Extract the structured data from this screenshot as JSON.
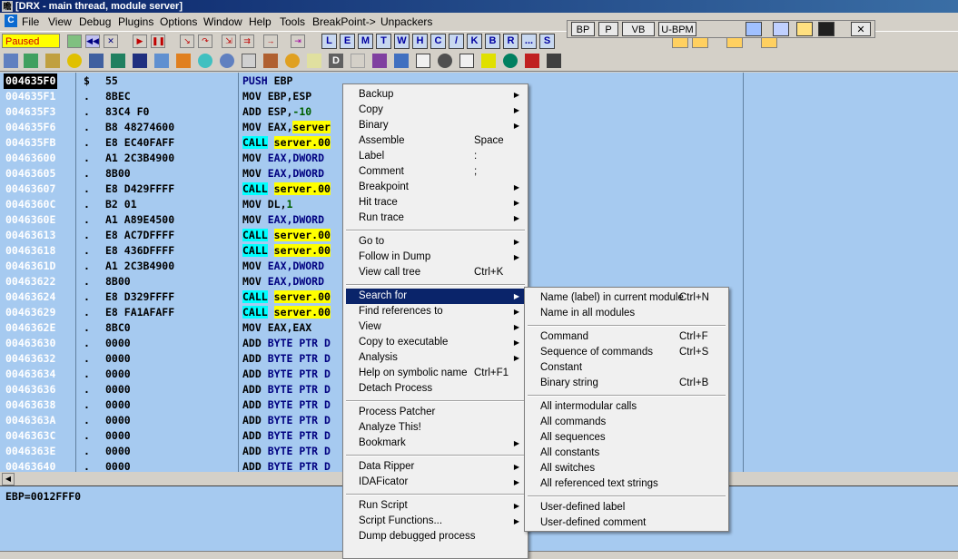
{
  "window": {
    "title": "[DRX - main thread, module server]",
    "icon_char": "瞻"
  },
  "menubar": {
    "items": [
      "File",
      "Debug",
      "View",
      "Plugins",
      "Options",
      "Window",
      "Help",
      "Tools",
      "BreakPoint->",
      "Unpackers"
    ]
  },
  "toolbar": {
    "status": "Paused",
    "letter_buttons": [
      "L",
      "E",
      "M",
      "T",
      "W",
      "H",
      "C",
      "/",
      "K",
      "B",
      "R",
      "...",
      "S"
    ]
  },
  "bp_toolbar": {
    "buttons": [
      "BP",
      "P",
      "VB",
      "U-BPM"
    ]
  },
  "disasm": {
    "rows": [
      {
        "addr": "004635F0",
        "mark": "$",
        "hex": "55",
        "op": "PUSH",
        "arg": "EBP",
        "call": false
      },
      {
        "addr": "004635F1",
        "mark": ".",
        "hex": "8BEC",
        "op": "MOV",
        "arg": "EBP,ESP",
        "call": false
      },
      {
        "addr": "004635F3",
        "mark": ".",
        "hex": "83C4 F0",
        "op": "ADD",
        "arg": "ESP,",
        "num": "-10",
        "call": false
      },
      {
        "addr": "004635F6",
        "mark": ".",
        "hex": "B8 48274600",
        "op": "MOV",
        "arg": "EAX,",
        "yarg": "server",
        "call": false
      },
      {
        "addr": "004635FB",
        "mark": ".",
        "hex": "E8 EC40FAFF",
        "op": "CALL",
        "yarg": "server.00",
        "call": true
      },
      {
        "addr": "00463600",
        "mark": ".",
        "hex": "A1 2C3B4900",
        "op": "MOV",
        "arg": "EAX,DWORD",
        "call": false
      },
      {
        "addr": "00463605",
        "mark": ".",
        "hex": "8B00",
        "op": "MOV",
        "arg": "EAX,DWORD",
        "call": false
      },
      {
        "addr": "00463607",
        "mark": ".",
        "hex": "E8 D429FFFF",
        "op": "CALL",
        "yarg": "server.00",
        "call": true
      },
      {
        "addr": "0046360C",
        "mark": ".",
        "hex": "B2 01",
        "op": "MOV",
        "arg": "DL,",
        "num": "1",
        "call": false
      },
      {
        "addr": "0046360E",
        "mark": ".",
        "hex": "A1 A89E4500",
        "op": "MOV",
        "arg": "EAX,DWORD",
        "call": false
      },
      {
        "addr": "00463613",
        "mark": ".",
        "hex": "E8 AC7DFFFF",
        "op": "CALL",
        "yarg": "server.00",
        "call": true
      },
      {
        "addr": "00463618",
        "mark": ".",
        "hex": "E8 436DFFFF",
        "op": "CALL",
        "yarg": "server.00",
        "call": true
      },
      {
        "addr": "0046361D",
        "mark": ".",
        "hex": "A1 2C3B4900",
        "op": "MOV",
        "arg": "EAX,DWORD",
        "call": false
      },
      {
        "addr": "00463622",
        "mark": ".",
        "hex": "8B00",
        "op": "MOV",
        "arg": "EAX,DWORD",
        "call": false
      },
      {
        "addr": "00463624",
        "mark": ".",
        "hex": "E8 D329FFFF",
        "op": "CALL",
        "yarg": "server.00",
        "call": true
      },
      {
        "addr": "00463629",
        "mark": ".",
        "hex": "E8 FA1AFAFF",
        "op": "CALL",
        "yarg": "server.00",
        "call": true
      },
      {
        "addr": "0046362E",
        "mark": ".",
        "hex": "8BC0",
        "op": "MOV",
        "arg": "EAX,EAX",
        "call": false
      },
      {
        "addr": "00463630",
        "mark": ".",
        "hex": "0000",
        "op": "ADD",
        "arg": "BYTE PTR D",
        "call": false
      },
      {
        "addr": "00463632",
        "mark": ".",
        "hex": "0000",
        "op": "ADD",
        "arg": "BYTE PTR D",
        "call": false
      },
      {
        "addr": "00463634",
        "mark": ".",
        "hex": "0000",
        "op": "ADD",
        "arg": "BYTE PTR D",
        "call": false
      },
      {
        "addr": "00463636",
        "mark": ".",
        "hex": "0000",
        "op": "ADD",
        "arg": "BYTE PTR D",
        "call": false
      },
      {
        "addr": "00463638",
        "mark": ".",
        "hex": "0000",
        "op": "ADD",
        "arg": "BYTE PTR D",
        "call": false
      },
      {
        "addr": "0046363A",
        "mark": ".",
        "hex": "0000",
        "op": "ADD",
        "arg": "BYTE PTR D",
        "call": false
      },
      {
        "addr": "0046363C",
        "mark": ".",
        "hex": "0000",
        "op": "ADD",
        "arg": "BYTE PTR D",
        "call": false
      },
      {
        "addr": "0046363E",
        "mark": ".",
        "hex": "0000",
        "op": "ADD",
        "arg": "BYTE PTR D",
        "call": false
      },
      {
        "addr": "00463640",
        "mark": ".",
        "hex": "0000",
        "op": "ADD",
        "arg": "BYTE PTR D",
        "call": false
      }
    ]
  },
  "info": {
    "text": "EBP=0012FFF0"
  },
  "context_menu": {
    "items": [
      {
        "label": "Backup",
        "shortcut": "",
        "sub": true
      },
      {
        "label": "Copy",
        "shortcut": "",
        "sub": true
      },
      {
        "label": "Binary",
        "shortcut": "",
        "sub": true
      },
      {
        "label": "Assemble",
        "shortcut": "Space",
        "sub": false
      },
      {
        "label": "Label",
        "shortcut": ":",
        "sub": false
      },
      {
        "label": "Comment",
        "shortcut": ";",
        "sub": false
      },
      {
        "label": "Breakpoint",
        "shortcut": "",
        "sub": true
      },
      {
        "label": "Hit trace",
        "shortcut": "",
        "sub": true
      },
      {
        "label": "Run trace",
        "shortcut": "",
        "sub": true
      },
      {
        "sep": true
      },
      {
        "label": "Go to",
        "shortcut": "",
        "sub": true
      },
      {
        "label": "Follow in Dump",
        "shortcut": "",
        "sub": true
      },
      {
        "label": "View call tree",
        "shortcut": "Ctrl+K",
        "sub": false
      },
      {
        "sep": true
      },
      {
        "label": "Search for",
        "shortcut": "",
        "sub": true,
        "hl": true
      },
      {
        "label": "Find references to",
        "shortcut": "",
        "sub": true
      },
      {
        "label": "View",
        "shortcut": "",
        "sub": true
      },
      {
        "label": "Copy to executable",
        "shortcut": "",
        "sub": true
      },
      {
        "label": "Analysis",
        "shortcut": "",
        "sub": true
      },
      {
        "label": "Help on symbolic name",
        "shortcut": "Ctrl+F1",
        "sub": false
      },
      {
        "label": "Detach Process",
        "shortcut": "",
        "sub": false
      },
      {
        "sep": true
      },
      {
        "label": "Process Patcher",
        "shortcut": "",
        "sub": false
      },
      {
        "label": "Analyze This!",
        "shortcut": "",
        "sub": false
      },
      {
        "label": "Bookmark",
        "shortcut": "",
        "sub": true
      },
      {
        "sep": true
      },
      {
        "label": "Data Ripper",
        "shortcut": "",
        "sub": true
      },
      {
        "label": "IDAFicator",
        "shortcut": "",
        "sub": true
      },
      {
        "sep": true
      },
      {
        "label": "Run Script",
        "shortcut": "",
        "sub": true
      },
      {
        "label": "Script Functions...",
        "shortcut": "",
        "sub": true
      },
      {
        "label": "Dump debugged process",
        "shortcut": "",
        "sub": false
      }
    ]
  },
  "submenu": {
    "items": [
      {
        "label": "Name (label) in current module",
        "shortcut": "Ctrl+N"
      },
      {
        "label": "Name in all modules",
        "shortcut": ""
      },
      {
        "sep": true
      },
      {
        "label": "Command",
        "shortcut": "Ctrl+F"
      },
      {
        "label": "Sequence of commands",
        "shortcut": "Ctrl+S"
      },
      {
        "label": "Constant",
        "shortcut": ""
      },
      {
        "label": "Binary string",
        "shortcut": "Ctrl+B"
      },
      {
        "sep": true
      },
      {
        "label": "All intermodular calls",
        "shortcut": ""
      },
      {
        "label": "All commands",
        "shortcut": ""
      },
      {
        "label": "All sequences",
        "shortcut": ""
      },
      {
        "label": "All constants",
        "shortcut": ""
      },
      {
        "label": "All switches",
        "shortcut": ""
      },
      {
        "label": "All referenced text strings",
        "shortcut": ""
      },
      {
        "sep": true
      },
      {
        "label": "User-defined label",
        "shortcut": ""
      },
      {
        "label": "User-defined comment",
        "shortcut": ""
      }
    ]
  },
  "colors": {
    "accent": "#0a246a",
    "pane_bg": "#a6caf0",
    "call_bg": "#00ffff",
    "yellow": "#ffff00"
  }
}
